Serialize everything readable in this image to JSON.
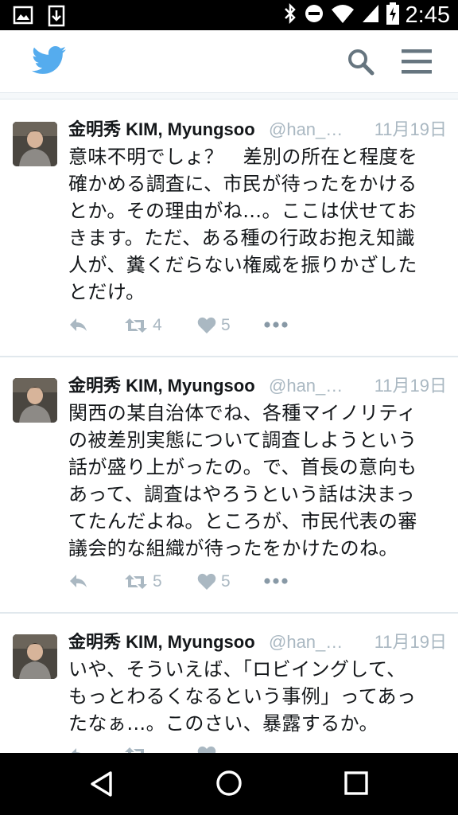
{
  "status_bar": {
    "time": "2:45",
    "icons": [
      "image-icon",
      "download-icon",
      "bluetooth-icon",
      "do-not-disturb-icon",
      "wifi-icon",
      "cell-signal-icon",
      "battery-charging-icon"
    ]
  },
  "header": {
    "icons": [
      "twitter-bird-icon",
      "search-icon",
      "hamburger-menu-icon"
    ],
    "brand_color": "#55acee"
  },
  "tweets": [
    {
      "name": "金明秀 KIM, Myungsoo",
      "handle": "@han_o…",
      "date": "11月19日",
      "text": "意味不明でしょ？　差別の所在と程度を\n確かめる調査に、市民が待ったをかける\nとか。その理由がね…。ここは伏せてお\nきます。ただ、ある種の行政お抱え知識\n人が、糞くだらない権威を振りかざした\nとだけ。",
      "retweets": "4",
      "likes": "5"
    },
    {
      "name": "金明秀 KIM, Myungsoo",
      "handle": "@han_o…",
      "date": "11月19日",
      "text": "関西の某自治体でね、各種マイノリティ\nの被差別実態について調査しようという\n話が盛り上がったの。で、首長の意向も\nあって、調査はやろうという話は決まっ\nてたんだよね。ところが、市民代表の審\n議会的な組織が待ったをかけたのね。",
      "retweets": "5",
      "likes": "5"
    },
    {
      "name": "金明秀 KIM, Myungsoo",
      "handle": "@han_o…",
      "date": "11月19日",
      "text": "いや、そういえば、「ロビイングして、\nもっとわるくなるという事例」ってあっ\nたなぁ…。このさい、暴露するか。",
      "retweets": "",
      "likes": ""
    }
  ],
  "nav_bar": {
    "icons": [
      "back-icon",
      "home-icon",
      "recents-icon"
    ]
  }
}
